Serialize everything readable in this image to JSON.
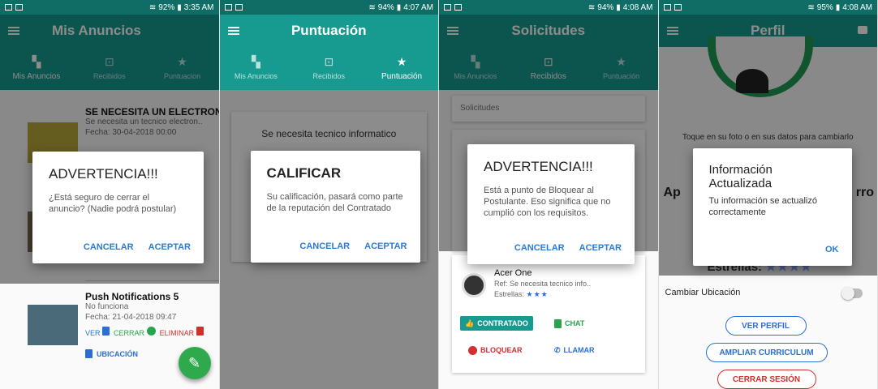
{
  "screens": [
    {
      "status": {
        "signal": "92%",
        "time": "3:35 AM"
      },
      "title": "Mis Anuncios",
      "tabs": [
        {
          "label": "Mis Anuncios"
        },
        {
          "label": "Recibidos"
        },
        {
          "label": "Puntuacion"
        }
      ],
      "list": [
        {
          "title": "SE NECESITA UN ELECTRON",
          "desc": "Se necesita un tecnico electron..",
          "fecha": "Fecha: 30-04-2018 00:00"
        },
        {
          "title": "Push Notifications 5",
          "desc": "No funciona",
          "fecha": "Fecha: 21-04-2018 09:47"
        }
      ],
      "actions": {
        "ver": "VER",
        "cerrar": "CERRAR",
        "eliminar": "ELIMINAR",
        "ubicacion": "UBICACIÓN"
      },
      "dialog": {
        "title": "ADVERTENCIA!!!",
        "body": "¿Está seguro de cerrar el anuncio? (Nadie podrá postular)",
        "cancel": "CANCELAR",
        "ok": "ACEPTAR"
      }
    },
    {
      "status": {
        "signal": "94%",
        "time": "4:07 AM"
      },
      "title": "Puntuación",
      "tabs": [
        {
          "label": "Mis Anuncios"
        },
        {
          "label": "Recibidos"
        },
        {
          "label": "Puntuación"
        }
      ],
      "card_text": "Se necesita tecnico informatico",
      "dialog": {
        "title": "CALIFICAR",
        "body": "Su calificación, pasará como parte de la reputación del Contratado",
        "cancel": "CANCELAR",
        "ok": "ACEPTAR"
      }
    },
    {
      "status": {
        "signal": "94%",
        "time": "4:08 AM"
      },
      "title": "Solicitudes",
      "tabs": [
        {
          "label": "Mis Anuncios"
        },
        {
          "label": "Recibidos"
        },
        {
          "label": "Puntuación"
        }
      ],
      "solicitudes_label": "Solicitudes",
      "applicant": {
        "name": "Acer One",
        "ref": "Ref: Se necesita tecnico info..",
        "estrellas": "Estrellas:",
        "stars": "★★★"
      },
      "buttons": {
        "contratado": "CONTRATADO",
        "chat": "CHAT",
        "bloquear": "BLOQUEAR",
        "llamar": "LLAMAR"
      },
      "dialog": {
        "title": "ADVERTENCIA!!!",
        "body": "Está a punto de Bloquear al Postulante. Eso significa que no cumplió con los requisitos.",
        "cancel": "CANCELAR",
        "ok": "ACEPTAR"
      }
    },
    {
      "status": {
        "signal": "95%",
        "time": "4:08 AM"
      },
      "title": "Perfil",
      "hint": "Toque en su foto o en sus datos para cambiarlo",
      "side_left": "Ap",
      "side_right": "rro",
      "estrellas": "Estrellas:",
      "stars": "★★★★",
      "cambiar_ubicacion": "Cambiar Ubicación",
      "buttons": {
        "ver_perfil": "VER PERFIL",
        "ampliar": "AMPLIAR CURRICULUM",
        "cerrar_sesion": "CERRAR SESIÓN"
      },
      "dialog": {
        "title": "Información Actualizada",
        "body": "Tu información se actualizó correctamente",
        "ok": "OK"
      }
    }
  ],
  "colors": {
    "primary": "#179b90",
    "primary_dark": "#0f6d66",
    "accent_blue": "#2a7bd6",
    "green": "#2aa34c",
    "red": "#d32f2f"
  }
}
